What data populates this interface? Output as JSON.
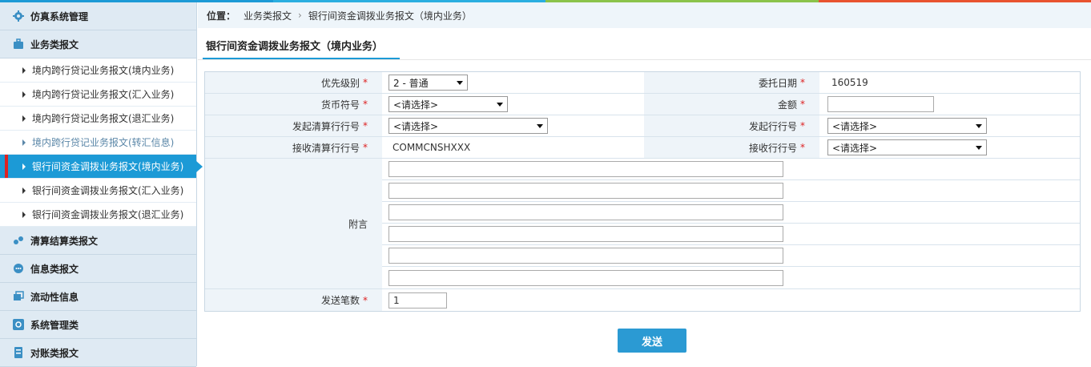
{
  "colors": {
    "accent": "#1c9ad6",
    "strip": [
      "#1c9ad6",
      "#2aaee0",
      "#8bc34a",
      "#e8532f",
      "#3aa0d8"
    ]
  },
  "sidebar": {
    "cats": [
      {
        "label": "仿真系统管理",
        "icon": "gear-icon"
      },
      {
        "label": "业务类报文",
        "icon": "briefcase-icon"
      }
    ],
    "subs": [
      {
        "label": "境内跨行贷记业务报文(境内业务)",
        "state": "normal"
      },
      {
        "label": "境内跨行贷记业务报文(汇入业务)",
        "state": "normal"
      },
      {
        "label": "境内跨行贷记业务报文(退汇业务)",
        "state": "normal"
      },
      {
        "label": "境内跨行贷记业务报文(转汇信息)",
        "state": "muted"
      },
      {
        "label": "银行间资金调拨业务报文(境内业务)",
        "state": "active"
      },
      {
        "label": "银行间资金调拨业务报文(汇入业务)",
        "state": "normal"
      },
      {
        "label": "银行间资金调拨业务报文(退汇业务)",
        "state": "normal"
      }
    ],
    "cats2": [
      {
        "label": "清算结算类报文",
        "icon": "coins-icon"
      },
      {
        "label": "信息类报文",
        "icon": "chat-icon"
      },
      {
        "label": "流动性信息",
        "icon": "layers-icon"
      },
      {
        "label": "系统管理类",
        "icon": "settings-icon"
      },
      {
        "label": "对账类报文",
        "icon": "ledger-icon"
      }
    ]
  },
  "breadcrumb": {
    "label": "位置：",
    "items": [
      "业务类报文",
      "银行间资金调拨业务报文（境内业务）"
    ]
  },
  "page_title": "银行间资金调拨业务报文（境内业务）",
  "form": {
    "priority": {
      "label": "优先级别",
      "value": "2 - 普通"
    },
    "entrust_date": {
      "label": "委托日期",
      "value": "160519"
    },
    "currency": {
      "label": "货币符号",
      "value": "<请选择>"
    },
    "amount": {
      "label": "金额",
      "value": ""
    },
    "send_clearing": {
      "label": "发起清算行行号",
      "value": "<请选择>"
    },
    "send_bank": {
      "label": "发起行行号",
      "value": "<请选择>"
    },
    "recv_clearing": {
      "label": "接收清算行行号",
      "value": "COMMCNSHXXX"
    },
    "recv_bank": {
      "label": "接收行行号",
      "value": "<请选择>"
    },
    "memo": {
      "label": "附言"
    },
    "count": {
      "label": "发送笔数",
      "value": "1"
    },
    "required_mark": "*"
  },
  "send_button": "发送"
}
